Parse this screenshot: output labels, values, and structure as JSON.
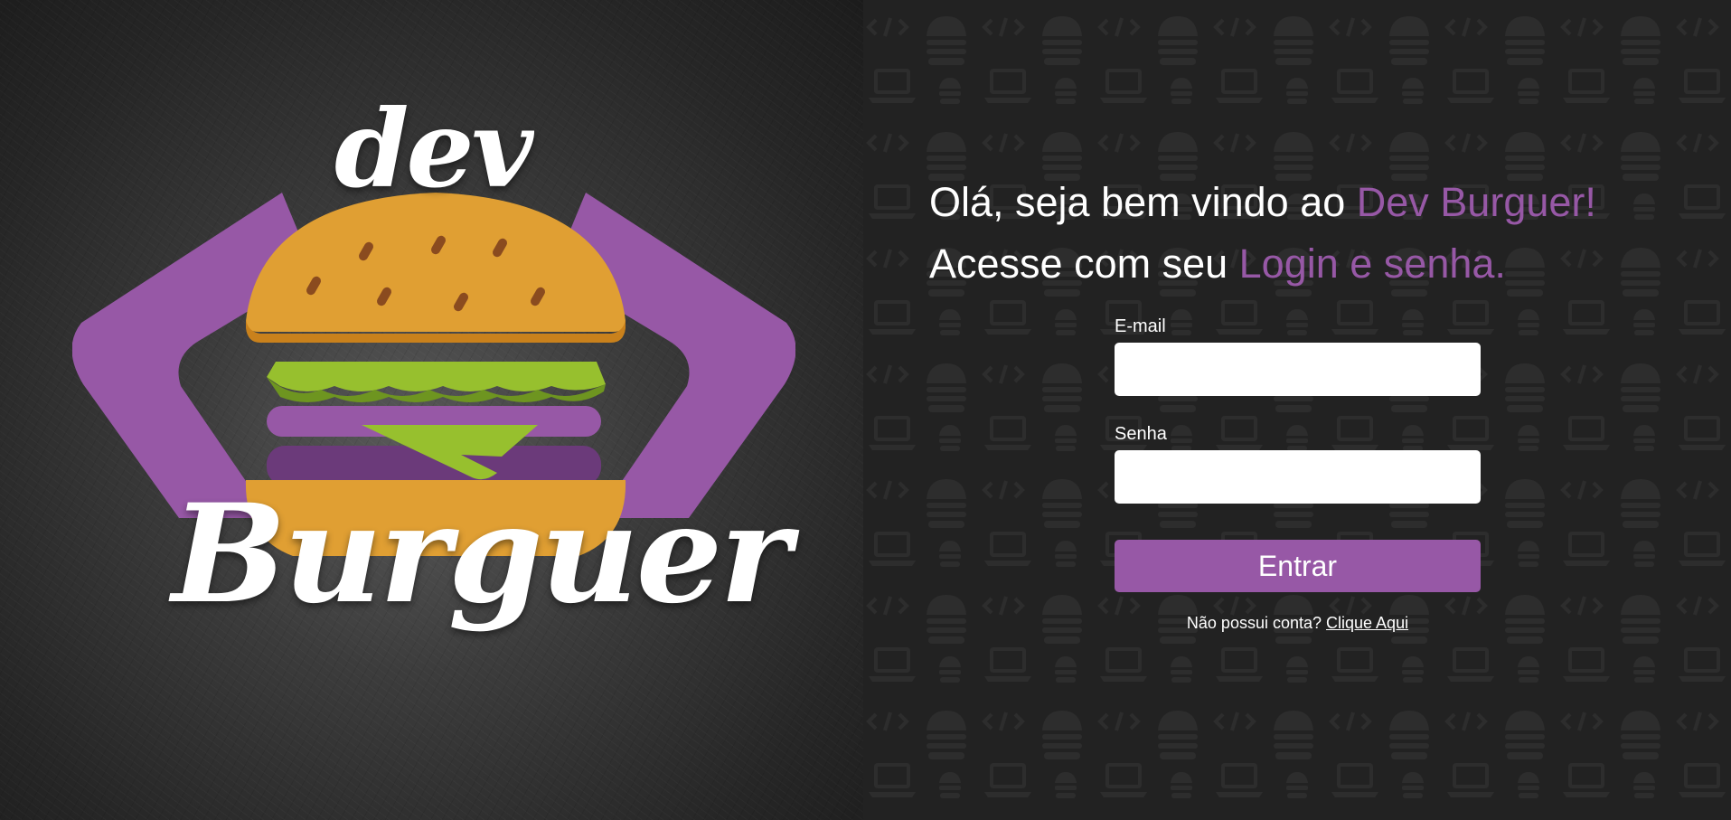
{
  "brand": {
    "logo_word_top": "dev",
    "logo_word_bottom": "Burguer",
    "colors": {
      "accent": "#9758a6",
      "bun": "#e09f33",
      "lettuce": "#97c02e"
    }
  },
  "greeting": {
    "line1_text": "Olá, seja bem vindo ao ",
    "line1_highlight": "Dev Burguer!",
    "line2_text": "Acesse com seu ",
    "line2_highlight": "Login e senha."
  },
  "form": {
    "email_label": "E-mail",
    "email_value": "",
    "password_label": "Senha",
    "password_value": "",
    "submit_label": "Entrar",
    "signup_text": "Não possui conta? ",
    "signup_link": "Clique Aqui"
  }
}
